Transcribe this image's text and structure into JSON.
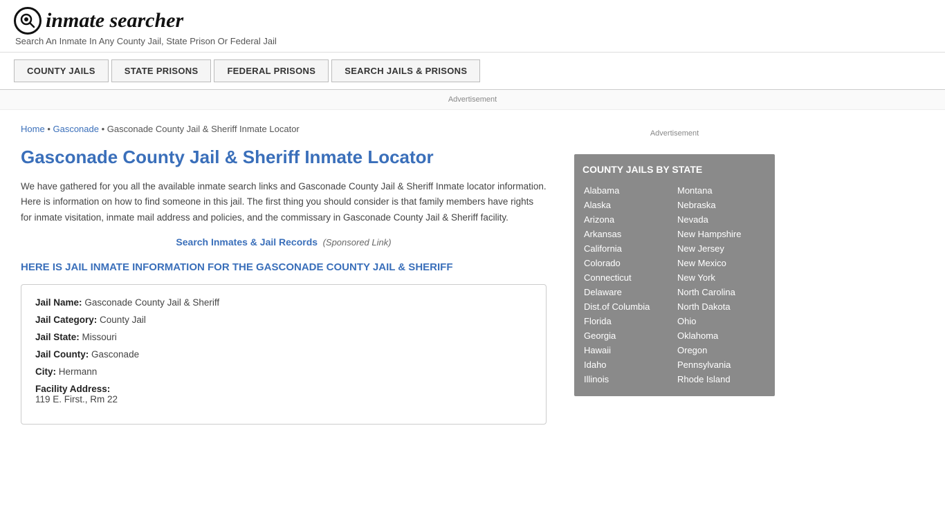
{
  "header": {
    "logo_icon": "🔍",
    "logo_text": "inmate searcher",
    "tagline": "Search An Inmate In Any County Jail, State Prison Or Federal Jail"
  },
  "nav": {
    "items": [
      {
        "label": "COUNTY JAILS",
        "id": "county-jails"
      },
      {
        "label": "STATE PRISONS",
        "id": "state-prisons"
      },
      {
        "label": "FEDERAL PRISONS",
        "id": "federal-prisons"
      },
      {
        "label": "SEARCH JAILS & PRISONS",
        "id": "search-jails-prisons"
      }
    ]
  },
  "ad_bar": {
    "text": "Advertisement"
  },
  "breadcrumb": {
    "home": "Home",
    "parent": "Gasconade",
    "current": "Gasconade County Jail & Sheriff Inmate Locator"
  },
  "page_title": "Gasconade County Jail & Sheriff Inmate Locator",
  "description": "We have gathered for you all the available inmate search links and Gasconade County Jail & Sheriff Inmate locator information. Here is information on how to find someone in this jail. The first thing you should consider is that family members have rights for inmate visitation, inmate mail address and policies, and the commissary in Gasconade County Jail & Sheriff facility.",
  "sponsored": {
    "link_text": "Search Inmates & Jail Records",
    "suffix": "(Sponsored Link)"
  },
  "section_heading": "HERE IS JAIL INMATE INFORMATION FOR THE GASCONADE COUNTY JAIL & SHERIFF",
  "jail_info": {
    "name_label": "Jail Name:",
    "name_value": "Gasconade County Jail & Sheriff",
    "category_label": "Jail Category:",
    "category_value": "County Jail",
    "state_label": "Jail State:",
    "state_value": "Missouri",
    "county_label": "Jail County:",
    "county_value": "Gasconade",
    "city_label": "City:",
    "city_value": "Hermann",
    "address_label": "Facility Address:",
    "address_value": "119 E. First., Rm 22"
  },
  "sidebar": {
    "ad_text": "Advertisement",
    "state_box_title": "COUNTY JAILS BY STATE",
    "states_col1": [
      "Alabama",
      "Alaska",
      "Arizona",
      "Arkansas",
      "California",
      "Colorado",
      "Connecticut",
      "Delaware",
      "Dist.of Columbia",
      "Florida",
      "Georgia",
      "Hawaii",
      "Idaho",
      "Illinois"
    ],
    "states_col2": [
      "Montana",
      "Nebraska",
      "Nevada",
      "New Hampshire",
      "New Jersey",
      "New Mexico",
      "New York",
      "North Carolina",
      "North Dakota",
      "Ohio",
      "Oklahoma",
      "Oregon",
      "Pennsylvania",
      "Rhode Island"
    ]
  }
}
